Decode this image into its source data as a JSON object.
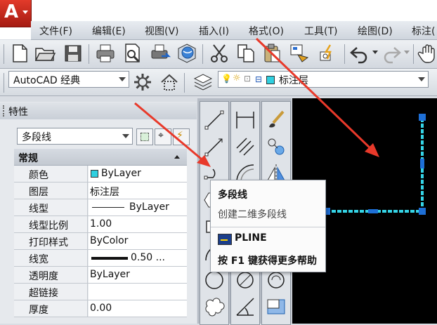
{
  "menu": {
    "items": [
      "文件(F)",
      "编辑(E)",
      "视图(V)",
      "插入(I)",
      "格式(O)",
      "工具(T)",
      "绘图(D)",
      "标注("
    ]
  },
  "workspace": {
    "value": "AutoCAD 经典"
  },
  "layer": {
    "value": "标注层"
  },
  "properties": {
    "title": "特性",
    "selection": "多段线",
    "section": "常规",
    "rows": [
      {
        "label": "颜色",
        "value": "ByLayer"
      },
      {
        "label": "图层",
        "value": "标注层"
      },
      {
        "label": "线型",
        "value": "ByLayer"
      },
      {
        "label": "线型比例",
        "value": "1.00"
      },
      {
        "label": "打印样式",
        "value": "ByColor"
      },
      {
        "label": "线宽",
        "value": "0.50 ..."
      },
      {
        "label": "透明度",
        "value": "ByLayer"
      },
      {
        "label": "超链接",
        "value": ""
      },
      {
        "label": "厚度",
        "value": "0.00"
      }
    ]
  },
  "tooltip": {
    "title": "多段线",
    "description": "创建二维多段线",
    "command": "PLINE",
    "help": "按 F1 键获得更多帮助"
  },
  "colors": {
    "app_red": "#c8281b",
    "arrow_red": "#e8392a",
    "polyline_cyan": "#35d4e6",
    "grip_blue": "#1e6fd6",
    "color_swatch": "#2fd0e0"
  }
}
